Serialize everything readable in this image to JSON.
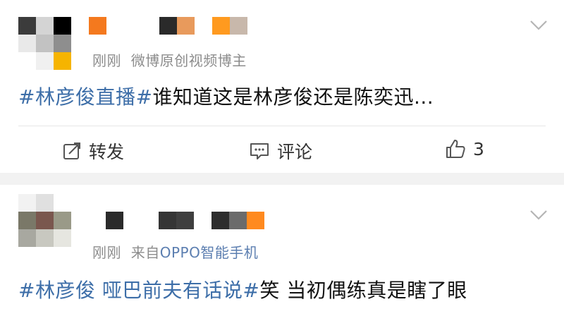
{
  "posts": [
    {
      "avatar_colors": [
        "#3b3b3b",
        "#d4d4d4",
        "#000000",
        "#e9e9e9",
        "#c2c2c2",
        "#8e8e8e",
        "#ffffff",
        "#f0f0f0",
        "#f6b400"
      ],
      "name_blocks": [
        "#f4791e",
        "#ffffff",
        "#ffffff",
        "#ffffff",
        "#2a2a2a",
        "#e89a5c",
        "#ffffff",
        "#ff9a1f",
        "#c8b8ab"
      ],
      "time": "刚刚",
      "source": "微博原创视频博主",
      "topic": "#林彦俊直播#",
      "text": "谁知道这是林彦俊还是陈奕迅...",
      "actions": {
        "repost": "转发",
        "comment": "评论",
        "like_count": "3"
      }
    },
    {
      "avatar_colors": [
        "#f2f2f2",
        "#e0e0e0",
        "#ffffff",
        "#7a7868",
        "#7a574e",
        "#9a9a88",
        "#a8a8a0",
        "#c8c8c0",
        "#e6e6e0"
      ],
      "name_blocks": [
        "#2b2b2b",
        "#ffffff",
        "#ffffff",
        "#353535",
        "#3f3f3f",
        "#ffffff",
        "#2e2e2e",
        "#6b6b6b",
        "#ff8a1f"
      ],
      "time": "刚刚",
      "source_prefix": "来自",
      "source_link": "OPPO智能手机",
      "topic": "#林彦俊 哑巴前夫有话说#",
      "text": "笑 当初偶练真是瞎了眼"
    }
  ]
}
